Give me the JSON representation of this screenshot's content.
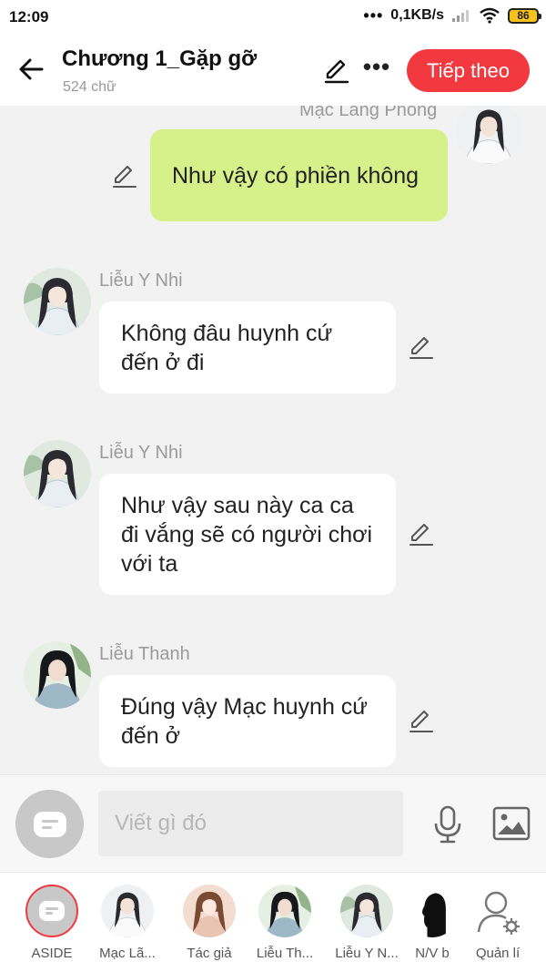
{
  "status_bar": {
    "time": "12:09",
    "speed": "0,1KB/s",
    "battery": "86"
  },
  "header": {
    "title": "Chương 1_Gặp gỡ",
    "word_count": "524 chữ",
    "next_label": "Tiếp theo"
  },
  "messages": [
    {
      "speaker": "Mạc Lang Phong",
      "side": "right",
      "text": "Như vậy có phiền không"
    },
    {
      "speaker": "Liễu Y Nhi",
      "side": "left",
      "text": "Không đâu huynh cứ đến ở đi"
    },
    {
      "speaker": "Liễu Y Nhi",
      "side": "left",
      "text": "Như vậy sau này ca ca đi vắng sẽ có người chơi với ta"
    },
    {
      "speaker": "Liễu Thanh",
      "side": "left",
      "text": "Đúng vậy Mạc huynh cứ đến ở"
    }
  ],
  "input": {
    "placeholder": "Viết gì đó"
  },
  "tray": [
    {
      "label": "ASIDE"
    },
    {
      "label": "Mạc Lã..."
    },
    {
      "label": "Tác giả"
    },
    {
      "label": "Liễu Th..."
    },
    {
      "label": "Liễu Y N..."
    },
    {
      "label": "N/V b"
    },
    {
      "label": "Quản lí"
    }
  ],
  "colors": {
    "accent": "#f2393f",
    "right_bubble": "#d6f08a",
    "left_bubble": "#ffffff",
    "background": "#f2f2f2"
  },
  "icons": [
    "back-arrow-icon",
    "pen-icon",
    "more-icon",
    "chat-icon",
    "microphone-icon",
    "image-icon",
    "manager-icon"
  ]
}
